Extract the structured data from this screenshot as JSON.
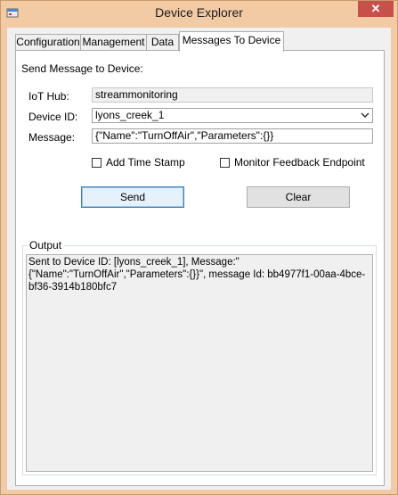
{
  "window": {
    "title": "Device Explorer",
    "close_glyph": "✕"
  },
  "tabs": [
    {
      "label": "Configuration",
      "active": false
    },
    {
      "label": "Management",
      "active": false
    },
    {
      "label": "Data",
      "active": false
    },
    {
      "label": "Messages To Device",
      "active": true
    }
  ],
  "form": {
    "heading": "Send Message to Device:",
    "iot_hub_label": "IoT Hub:",
    "iot_hub_value": "streammonitoring",
    "device_id_label": "Device ID:",
    "device_id_value": "lyons_creek_1",
    "message_label": "Message:",
    "message_value": "{\"Name\":\"TurnOffAir\",\"Parameters\":{}}",
    "add_timestamp_label": "Add Time Stamp",
    "add_timestamp_checked": false,
    "monitor_feedback_label": "Monitor Feedback Endpoint",
    "monitor_feedback_checked": false,
    "send_label": "Send",
    "clear_label": "Clear"
  },
  "output": {
    "legend": "Output",
    "text": "Sent to Device ID: [lyons_creek_1], Message:\"{\"Name\":\"TurnOffAir\",\"Parameters\":{}}\", message Id: bb4977f1-00aa-4bce-bf36-3914b180bfc7"
  }
}
